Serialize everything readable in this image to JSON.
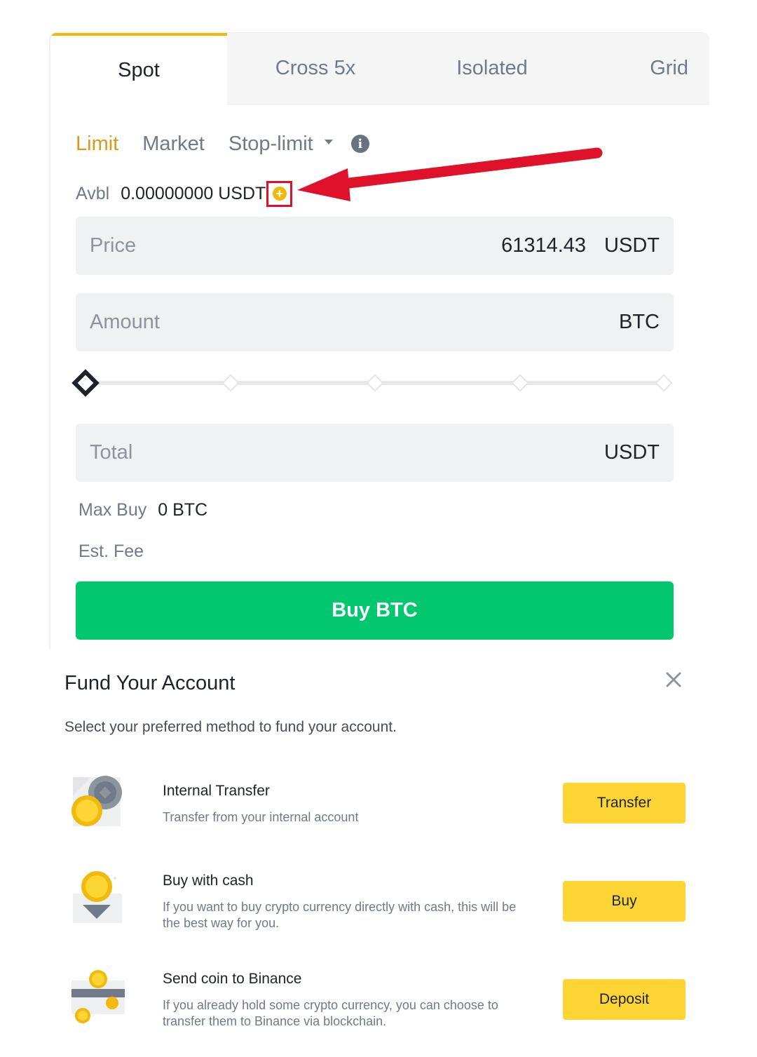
{
  "tabs": [
    {
      "label": "Spot"
    },
    {
      "label": "Cross 5x"
    },
    {
      "label": "Isolated"
    },
    {
      "label": "Grid"
    }
  ],
  "order_types": {
    "limit": "Limit",
    "market": "Market",
    "stop_limit": "Stop-limit"
  },
  "avbl": {
    "label": "Avbl",
    "value": "0.00000000 USDT"
  },
  "price": {
    "label": "Price",
    "value": "61314.43",
    "unit": "USDT"
  },
  "amount": {
    "label": "Amount",
    "value": "",
    "unit": "BTC"
  },
  "slider": {
    "value_percent": 0,
    "steps": [
      0,
      25,
      50,
      75,
      100
    ]
  },
  "total": {
    "label": "Total",
    "value": "",
    "unit": "USDT"
  },
  "max_buy": {
    "label": "Max Buy",
    "value": "0 BTC"
  },
  "est_fee": {
    "label": "Est. Fee"
  },
  "buy_button": "Buy BTC",
  "colors": {
    "accent": "#F0B90B",
    "buy_green": "#03C76F",
    "annotation_red": "#E0112B",
    "button_yellow": "#FCD535"
  },
  "fund": {
    "title": "Fund Your Account",
    "subtitle": "Select your preferred method to fund your account.",
    "methods": [
      {
        "icon": "transfer-coins-icon",
        "title": "Internal Transfer",
        "desc": "Transfer from your internal account",
        "button": "Transfer"
      },
      {
        "icon": "cash-coin-icon",
        "title": "Buy with cash",
        "desc": "If you want to buy crypto currency directly with cash, this will be the best way for you.",
        "button": "Buy"
      },
      {
        "icon": "send-coin-card-icon",
        "title": "Send coin to Binance",
        "desc": "If you already hold some crypto currency, you can choose to transfer them to Binance via blockchain.",
        "button": "Deposit"
      }
    ]
  }
}
